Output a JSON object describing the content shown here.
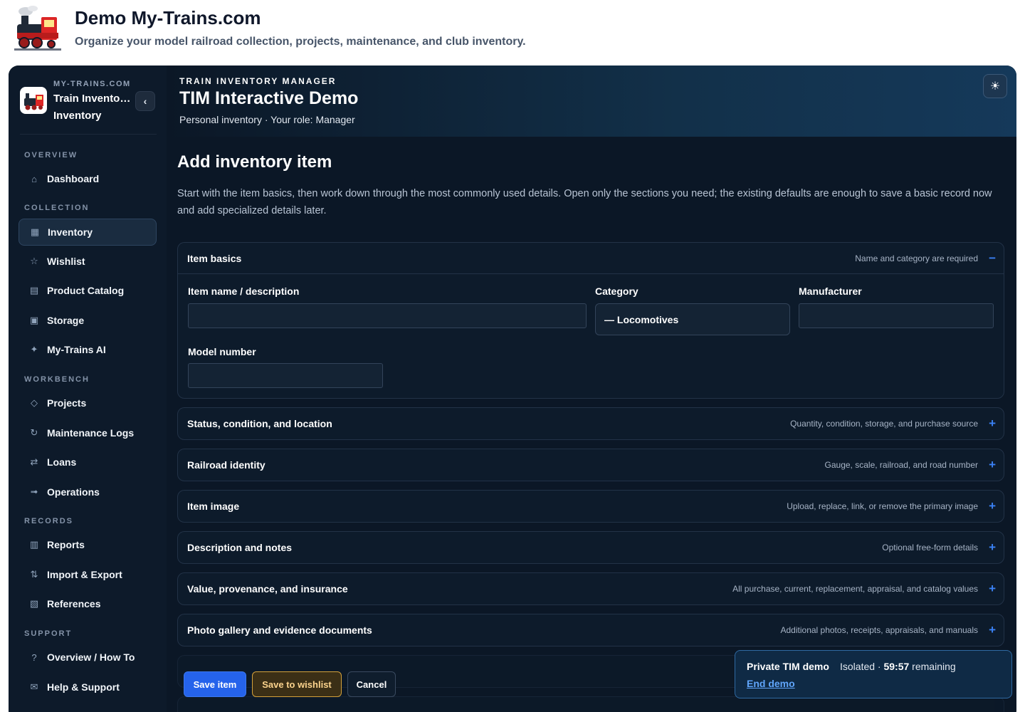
{
  "site": {
    "title": "Demo My-Trains.com",
    "subtitle": "Organize your model railroad collection, projects, maintenance, and club inventory."
  },
  "sidebar": {
    "brand_kicker": "MY-TRAINS.COM",
    "brand_name": "Train Inventory Manager",
    "brand_sub": "Inventory",
    "collapse_glyph": "‹",
    "sections": [
      {
        "label": "OVERVIEW"
      },
      {
        "label": "COLLECTION"
      },
      {
        "label": "WORKBENCH"
      },
      {
        "label": "RECORDS"
      },
      {
        "label": "SUPPORT"
      }
    ],
    "items": [
      {
        "label": "Dashboard",
        "icon": "home-icon",
        "glyph": "⌂"
      },
      {
        "label": "Inventory",
        "icon": "grid-icon",
        "glyph": "▦",
        "active": true
      },
      {
        "label": "Wishlist",
        "icon": "star-icon",
        "glyph": "☆"
      },
      {
        "label": "Product Catalog",
        "icon": "catalog-icon",
        "glyph": "▤"
      },
      {
        "label": "Storage",
        "icon": "storage-icon",
        "glyph": "▣"
      },
      {
        "label": "My-Trains AI",
        "icon": "sparkle-icon",
        "glyph": "✦"
      },
      {
        "label": "Projects",
        "icon": "diamond-icon",
        "glyph": "◇"
      },
      {
        "label": "Maintenance Logs",
        "icon": "refresh-icon",
        "glyph": "↻"
      },
      {
        "label": "Loans",
        "icon": "swap-icon",
        "glyph": "⇄"
      },
      {
        "label": "Operations",
        "icon": "arrow-icon",
        "glyph": "➟"
      },
      {
        "label": "Reports",
        "icon": "bars-icon",
        "glyph": "▥"
      },
      {
        "label": "Import & Export",
        "icon": "import-export-icon",
        "glyph": "⇅"
      },
      {
        "label": "References",
        "icon": "references-icon",
        "glyph": "▧"
      },
      {
        "label": "Overview / How To",
        "icon": "question-icon",
        "glyph": "?"
      },
      {
        "label": "Help & Support",
        "icon": "mail-icon",
        "glyph": "✉"
      }
    ]
  },
  "banner": {
    "kicker": "TRAIN INVENTORY MANAGER",
    "title": "TIM Interactive Demo",
    "subtitle": "Personal inventory · Your role: Manager",
    "theme_glyph": "☀"
  },
  "main": {
    "title": "Add inventory item",
    "intro": "Start with the item basics, then work down through the most commonly used details. Open only the sections you need; the existing defaults are enough to save a basic record now and add specialized details later.",
    "basics": {
      "title": "Item basics",
      "hint": "Name and category are required",
      "toggle": "−",
      "fields": {
        "name_label": "Item name / description",
        "name_value": "",
        "category_label": "Category",
        "category_value": "— Locomotives",
        "manufacturer_label": "Manufacturer",
        "manufacturer_value": "",
        "model_label": "Model number",
        "model_value": ""
      }
    },
    "sections": [
      {
        "title": "Status, condition, and location",
        "hint": "Quantity, condition, storage, and purchase source",
        "toggle": "+"
      },
      {
        "title": "Railroad identity",
        "hint": "Gauge, scale, railroad, and road number",
        "toggle": "+"
      },
      {
        "title": "Item image",
        "hint": "Upload, replace, link, or remove the primary image",
        "toggle": "+"
      },
      {
        "title": "Description and notes",
        "hint": "Optional free-form details",
        "toggle": "+"
      },
      {
        "title": "Value, provenance, and insurance",
        "hint": "All purchase, current, replacement, appraisal, and catalog values",
        "toggle": "+"
      },
      {
        "title": "Photo gallery and evidence documents",
        "hint": "Additional photos, receipts, appraisals, and manuals",
        "toggle": "+"
      }
    ]
  },
  "actions": {
    "save": "Save item",
    "wishlist": "Save to wishlist",
    "cancel": "Cancel"
  },
  "toast": {
    "title": "Private TIM demo",
    "status_prefix": "Isolated · ",
    "time": "59:57",
    "status_suffix": " remaining",
    "link": "End demo"
  },
  "colors": {
    "accent": "#2563eb",
    "wishlist": "#d4a13a",
    "background": "#0b1726"
  }
}
